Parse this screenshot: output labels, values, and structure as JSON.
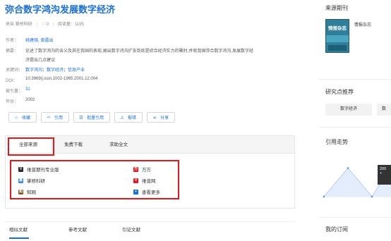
{
  "article": {
    "title": "弥合数字鸿沟发展数字经济",
    "source_label": "来自 掌桥科研",
    "likes": "0",
    "reads_label": "阅读量：1195"
  },
  "meta": {
    "authors_label": "作者：",
    "authors": "姚建强, 袁露出",
    "abstract_label": "摘要：",
    "abstract_line1": "论述了数字鸿沟的含义及其在我国的表现,阐出数字鸿沟扩张到底是综合经济实力的聚时,并就我国弥合数字鸿沟,发展数字经",
    "abstract_line2": "济提出几点建议",
    "keywords_label": "关键词：",
    "keywords": "数字鸿沟；数字经济；信息产业",
    "doi_label": "DOI：",
    "doi": "10.3969/j.issn.1002-1965.2001.12.004",
    "cited_label": "被引量：",
    "cited": "31",
    "year_label": "年份：",
    "year": "2002"
  },
  "actions": [
    {
      "label": "收藏",
      "icon": "star-icon",
      "glyph": "☆"
    },
    {
      "label": "引用",
      "icon": "code-icon",
      "glyph": "‹›"
    },
    {
      "label": "批量引用",
      "icon": "list-icon",
      "glyph": "☰"
    },
    {
      "label": "报错",
      "icon": "warning-icon",
      "glyph": "⚠"
    },
    {
      "label": "分享",
      "icon": "share-icon",
      "glyph": "⋖"
    }
  ],
  "source_tabs": [
    "全部来源",
    "免费下载",
    "求助全文"
  ],
  "sources_left": [
    {
      "label": "维普期刊专业版",
      "icon": "vip-journal-icon",
      "color": "#2c2c2c",
      "glyph": "V"
    },
    {
      "label": "掌桥科研",
      "icon": "zhangqiao-icon",
      "color": "#3a8ee6",
      "glyph": "掌"
    },
    {
      "label": "知网",
      "icon": "cnki-icon",
      "color": "#8a5a2b",
      "glyph": "知"
    }
  ],
  "sources_right": [
    {
      "label": "万方",
      "icon": "wanfang-icon",
      "color": "#e6161a",
      "glyph": "万"
    },
    {
      "label": "维普网",
      "icon": "vip-web-icon",
      "color": "#e6161a",
      "glyph": "V"
    },
    {
      "label": "查看更多",
      "icon": "plus-icon",
      "color": "#1a6ed8",
      "glyph": "+"
    }
  ],
  "bottom_tabs": [
    "相似文献",
    "参考文献",
    "引证文献"
  ],
  "sidebar": {
    "source_journal_title": "来源期刊",
    "journal_name": "情报杂志",
    "cover_title": "情报杂志",
    "hotspot_title": "研究点推荐",
    "keywords": [
      "数字经济",
      "数"
    ],
    "trend_title": "引用走势",
    "tooltip_year": "200",
    "subscription_title": "我的订阅"
  },
  "chart_data": {
    "type": "area",
    "title": "引用走势",
    "values": [
      0,
      3,
      0,
      4,
      0
    ],
    "highlight_index": 3,
    "color": "#a9c4f2"
  }
}
